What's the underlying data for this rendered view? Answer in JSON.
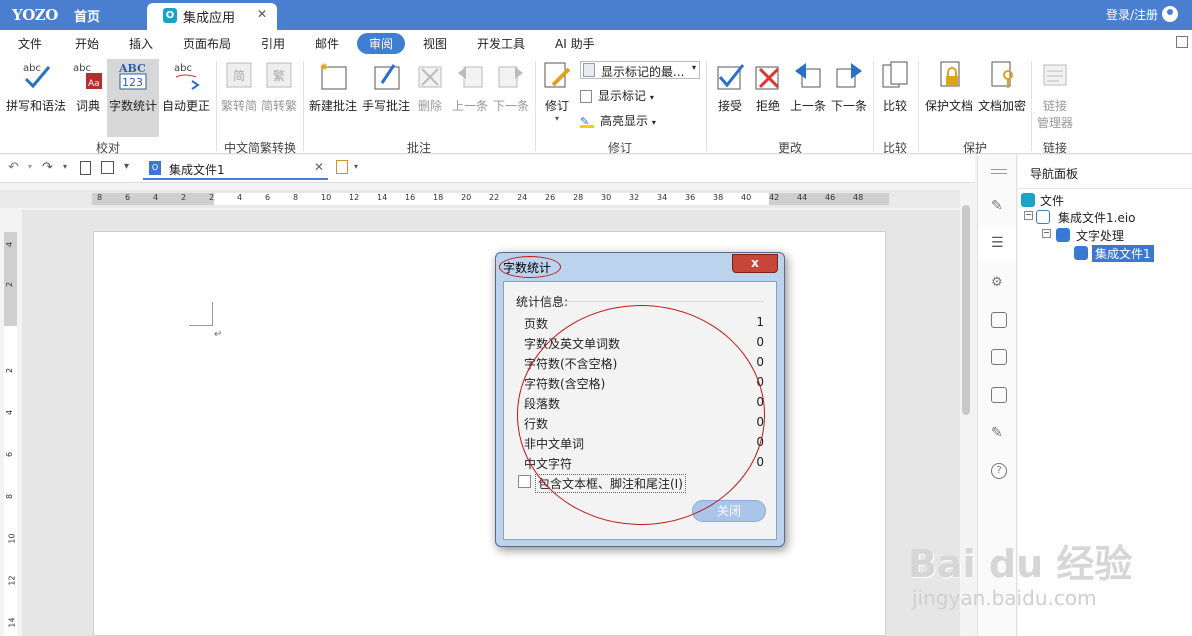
{
  "titlebar": {
    "logo": "YOZO",
    "home": "首页",
    "tab": "集成应用",
    "tab_icon": "O",
    "login": "登录/注册"
  },
  "menu": [
    "文件",
    "开始",
    "插入",
    "页面布局",
    "引用",
    "邮件",
    "审阅",
    "视图",
    "开发工具",
    "AI 助手"
  ],
  "ribbon": {
    "spell": "拼写和语法",
    "dict": "词典",
    "wordcount": "字数统计",
    "autocorrect": "自动更正",
    "group_proof": "校对",
    "trad_to_simp": "繁转简",
    "simp_to_trad": "简转繁",
    "group_chinese": "中文简繁转换",
    "new_comment": "新建批注",
    "hand_comment": "手写批注",
    "delete": "删除",
    "prev": "上一条",
    "next": "下一条",
    "group_comment": "批注",
    "revise": "修订",
    "show_final": "显示标记的最...",
    "show_markup": "显示标记",
    "highlight": "高亮显示",
    "group_revise": "修订",
    "accept": "接受",
    "reject": "拒绝",
    "prev2": "上一条",
    "next2": "下一条",
    "group_change": "更改",
    "compare": "比较",
    "group_compare": "比较",
    "protect_doc": "保护文档",
    "encrypt_doc": "文档加密",
    "group_protect": "保护",
    "link_manager_1": "链接",
    "link_manager_2": "管理器",
    "group_link": "链接",
    "abc_label": "ABC",
    "num_label": "123"
  },
  "quickbar": {
    "doc_tab": "集成文件1",
    "doc_icon": "O"
  },
  "ruler": {
    "marks": [
      "8",
      "6",
      "4",
      "2",
      "2",
      "4",
      "6",
      "8",
      "10",
      "12",
      "14",
      "16",
      "18",
      "20",
      "22",
      "24",
      "26",
      "28",
      "30",
      "32",
      "34",
      "36",
      "38",
      "40",
      "42",
      "44",
      "46",
      "48"
    ],
    "vmarks": [
      "4",
      "2",
      "2",
      "4",
      "6",
      "8",
      "10",
      "12",
      "14"
    ]
  },
  "nav": {
    "title": "导航面板",
    "items": [
      "文件",
      "集成文件1.eio",
      "文字处理",
      "集成文件1"
    ]
  },
  "dialog": {
    "title": "字数统计",
    "close_x": "x",
    "section": "统计信息:",
    "rows": [
      {
        "label": "页数",
        "value": "1"
      },
      {
        "label": "字数及英文单词数",
        "value": "0"
      },
      {
        "label": "字符数(不含空格)",
        "value": "0"
      },
      {
        "label": "字符数(含空格)",
        "value": "0"
      },
      {
        "label": "段落数",
        "value": "0"
      },
      {
        "label": "行数",
        "value": "0"
      },
      {
        "label": "非中文单词",
        "value": "0"
      },
      {
        "label": "中文字符",
        "value": "0"
      }
    ],
    "checkbox": "包含文本框、脚注和尾注(I)",
    "close_button": "关闭"
  },
  "watermark": {
    "line1": "Bai du 经验",
    "line2": "jingyan.baidu.com"
  }
}
